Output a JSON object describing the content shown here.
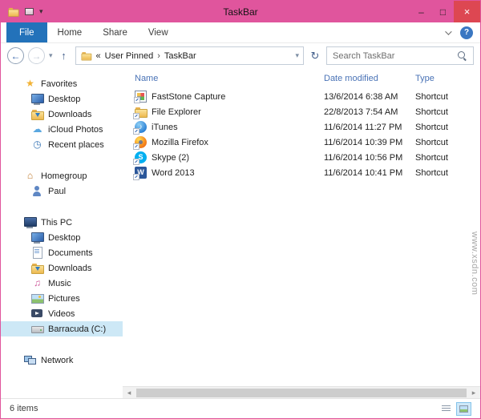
{
  "titlebar": {
    "title": "TaskBar"
  },
  "glyphs": {
    "caret_down": "▾",
    "back": "←",
    "forward": "→",
    "up": "↑",
    "refresh": "↻",
    "breadcrumb_prefix": "«",
    "breadcrumb_sep": "›",
    "help": "?",
    "min": "–",
    "max": "□",
    "close": "×",
    "scroll_left": "◂",
    "scroll_right": "▸",
    "star": "★",
    "cloud": "☁",
    "clock": "◷",
    "house": "⌂",
    "music": "♫",
    "music_note": "♪",
    "skype_letter": "S",
    "word_letter": "W"
  },
  "ribbon": {
    "tabs": [
      {
        "label": "File"
      },
      {
        "label": "Home"
      },
      {
        "label": "Share"
      },
      {
        "label": "View"
      }
    ]
  },
  "nav": {
    "breadcrumb_root": "User Pinned",
    "breadcrumb_current": "TaskBar",
    "search_placeholder": "Search TaskBar"
  },
  "sidebar": {
    "groups": [
      {
        "label": "Favorites",
        "items": [
          {
            "label": "Desktop"
          },
          {
            "label": "Downloads"
          },
          {
            "label": "iCloud Photos"
          },
          {
            "label": "Recent places"
          }
        ]
      },
      {
        "label": "Homegroup",
        "items": [
          {
            "label": "Paul"
          }
        ]
      },
      {
        "label": "This PC",
        "items": [
          {
            "label": "Desktop"
          },
          {
            "label": "Documents"
          },
          {
            "label": "Downloads"
          },
          {
            "label": "Music"
          },
          {
            "label": "Pictures"
          },
          {
            "label": "Videos"
          },
          {
            "label": "Barracuda (C:)"
          }
        ]
      },
      {
        "label": "Network",
        "items": []
      }
    ]
  },
  "filelist": {
    "columns": [
      {
        "label": "Name"
      },
      {
        "label": "Date modified"
      },
      {
        "label": "Type"
      }
    ],
    "rows": [
      {
        "name": "FastStone Capture",
        "date": "13/6/2014 6:38 AM",
        "type": "Shortcut"
      },
      {
        "name": "File Explorer",
        "date": "22/8/2013 7:54 AM",
        "type": "Shortcut"
      },
      {
        "name": "iTunes",
        "date": "11/6/2014 11:27 PM",
        "type": "Shortcut"
      },
      {
        "name": "Mozilla Firefox",
        "date": "11/6/2014 10:39 PM",
        "type": "Shortcut"
      },
      {
        "name": "Skype (2)",
        "date": "11/6/2014 10:56 PM",
        "type": "Shortcut"
      },
      {
        "name": "Word 2013",
        "date": "11/6/2014 10:41 PM",
        "type": "Shortcut"
      }
    ]
  },
  "statusbar": {
    "count": "6 items"
  },
  "watermark": "www.xsdn.com"
}
